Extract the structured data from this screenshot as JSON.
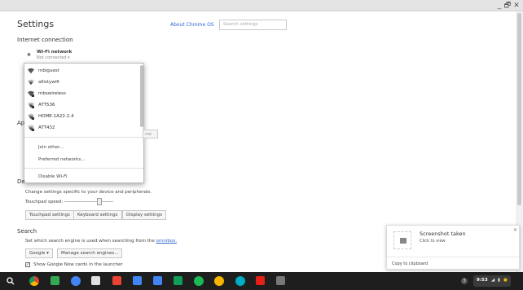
{
  "window_controls": {
    "minimize": "_",
    "restore": "🗗",
    "close": "✕"
  },
  "header": {
    "title": "Settings",
    "about_link": "About Chrome OS",
    "search_placeholder": "Search settings"
  },
  "internet": {
    "title": "Internet connection",
    "current_network": "Wi-Fi network",
    "current_status": "Not connected",
    "networks": [
      "mbiguest",
      "allistywifi",
      "mbswireless",
      "ATT536",
      "HOME-1A22-2.4",
      "ATT432"
    ],
    "join_other": "Join other...",
    "preferred": "Preferred networks...",
    "disable_wifi": "Disable Wi-Fi"
  },
  "appearance": {
    "title_partial": "Ap",
    "behind_button_partial": "me"
  },
  "device": {
    "title_partial": "De",
    "description": "Change settings specific to your device and peripherals.",
    "touchpad_label": "Touchpad speed:",
    "touchpad_speed_fraction": 0.7,
    "buttons": [
      "Touchpad settings",
      "Keyboard settings",
      "Display settings"
    ]
  },
  "search": {
    "title": "Search",
    "description": "Set which search engine is used when searching from the",
    "omnibox_link": "omnibox.",
    "engine": "Google",
    "manage_button": "Manage search engines...",
    "google_now_label": "Show Google Now cards in the launcher",
    "google_now_checked": true
  },
  "notification": {
    "title": "Screenshot taken",
    "subtitle": "Click to view",
    "action": "Copy to clipboard",
    "close": "×"
  },
  "taskbar": {
    "apps": [
      "launcher",
      "chrome",
      "files",
      "chrome-2",
      "store",
      "gmail",
      "docs",
      "docs-2",
      "sheets",
      "spotify",
      "headphones",
      "hangouts",
      "youtube",
      "screenshot"
    ],
    "notification_count": "3",
    "time": "9:53"
  },
  "colors": {
    "accent": "#3367d6",
    "taskbar": "#1e1e1e"
  }
}
